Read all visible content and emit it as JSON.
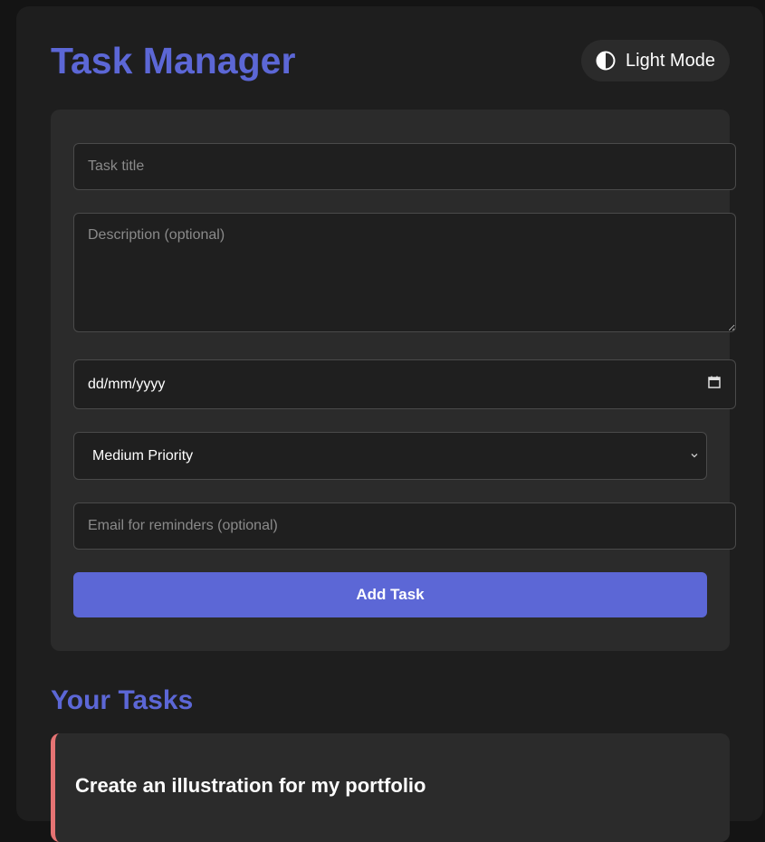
{
  "header": {
    "title": "Task Manager",
    "theme_toggle_label": "Light Mode",
    "theme_toggle_icon": "contrast-icon"
  },
  "form": {
    "title_placeholder": "Task title",
    "description_placeholder": "Description (optional)",
    "date_value": "dd/mm/yyyy",
    "date_icon": "calendar-icon",
    "priority_selected": "Medium Priority",
    "email_placeholder": "Email for reminders (optional)",
    "add_label": "Add Task"
  },
  "tasks": {
    "section_title": "Your Tasks",
    "items": [
      {
        "title": "Create an illustration for my portfolio",
        "priority_color": "#e57373"
      }
    ]
  },
  "colors": {
    "accent": "#5c67d6",
    "background": "#1e1e1e",
    "card": "#2b2b2b"
  }
}
